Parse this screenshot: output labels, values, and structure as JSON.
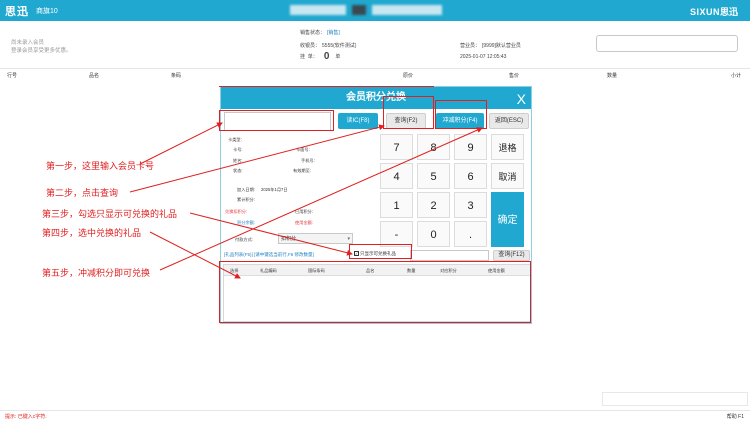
{
  "topbar": {
    "logo": "思迅",
    "store_name": "商旗10",
    "brand_latin": "SIXUN",
    "brand_cn": "思迅"
  },
  "notice": {
    "line1": "尚未录入会员",
    "line2": "登录会员享受更多优惠。"
  },
  "info": {
    "sales_status_label": "销售状态：",
    "sales_status_value": "[销售]",
    "cashier_label": "收银员：",
    "cashier_value": "5555(软件测试)",
    "sales_person_label": "营业员：",
    "sales_person_value": "[9999]默认营业员",
    "row_label_a": "挂",
    "row_label_b": "单：",
    "pending_count": "0",
    "pending_unit": "单",
    "datetime": "2025-01-07 12:05:43"
  },
  "columns": [
    "行号",
    "品名",
    "条码",
    "原价",
    "售价",
    "数量",
    "小计"
  ],
  "modal": {
    "title": "会员积分兑换",
    "close": "X",
    "card_placeholder": "",
    "read_ic": "读IC(F8)",
    "query": "查询(F2)",
    "deduct": "冲减积分(F4)",
    "back": "返回(ESC)",
    "card_type": "卡类型:",
    "card_no": "卡号:",
    "face_no": "卡面号:",
    "name": "姓名:",
    "phone": "手机号:",
    "status": "状态:",
    "valid_until": "有效期至:",
    "join_date_label": "加入日期:",
    "join_date": "2025年1月7日",
    "accum_points": "累计积分:",
    "redeem_points": "兑换扣积分:",
    "used_points": "已用积分:",
    "points_label": "积分余额:",
    "use_amount": "使用金额:",
    "pay_method": "付款方式:",
    "pay_value": "扣积分",
    "keys": [
      "7",
      "8",
      "9",
      "退格",
      "4",
      "5",
      "6",
      "取消",
      "1",
      "2",
      "3",
      "确定",
      "-",
      "0",
      "."
    ],
    "gift_list_label": "[礼品列表(F5)] [请中键选当前行,F6 修改数量]",
    "only_redeemable": "只显示可兑换礼品",
    "gift_query": "查询(F12)",
    "table_headers": [
      "选择",
      "礼品编码",
      "国际条码",
      "品名",
      "数量",
      "对应积分",
      "使用金额"
    ]
  },
  "annotations": {
    "step1": "第一步，这里输入会员卡号",
    "step2": "第二步，点击查询",
    "step3": "第三步，勾选只显示可兑换的礼品",
    "step4": "第四步，选中兑换的礼品",
    "step5": "第五步，冲减积分即可兑换"
  },
  "footer": {
    "hint": "提示:   已键入c字符.",
    "help": "帮助 F1"
  },
  "colors": {
    "accent": "#21a8d0",
    "annotation": "#e02020",
    "link": "#1e7fc1"
  }
}
